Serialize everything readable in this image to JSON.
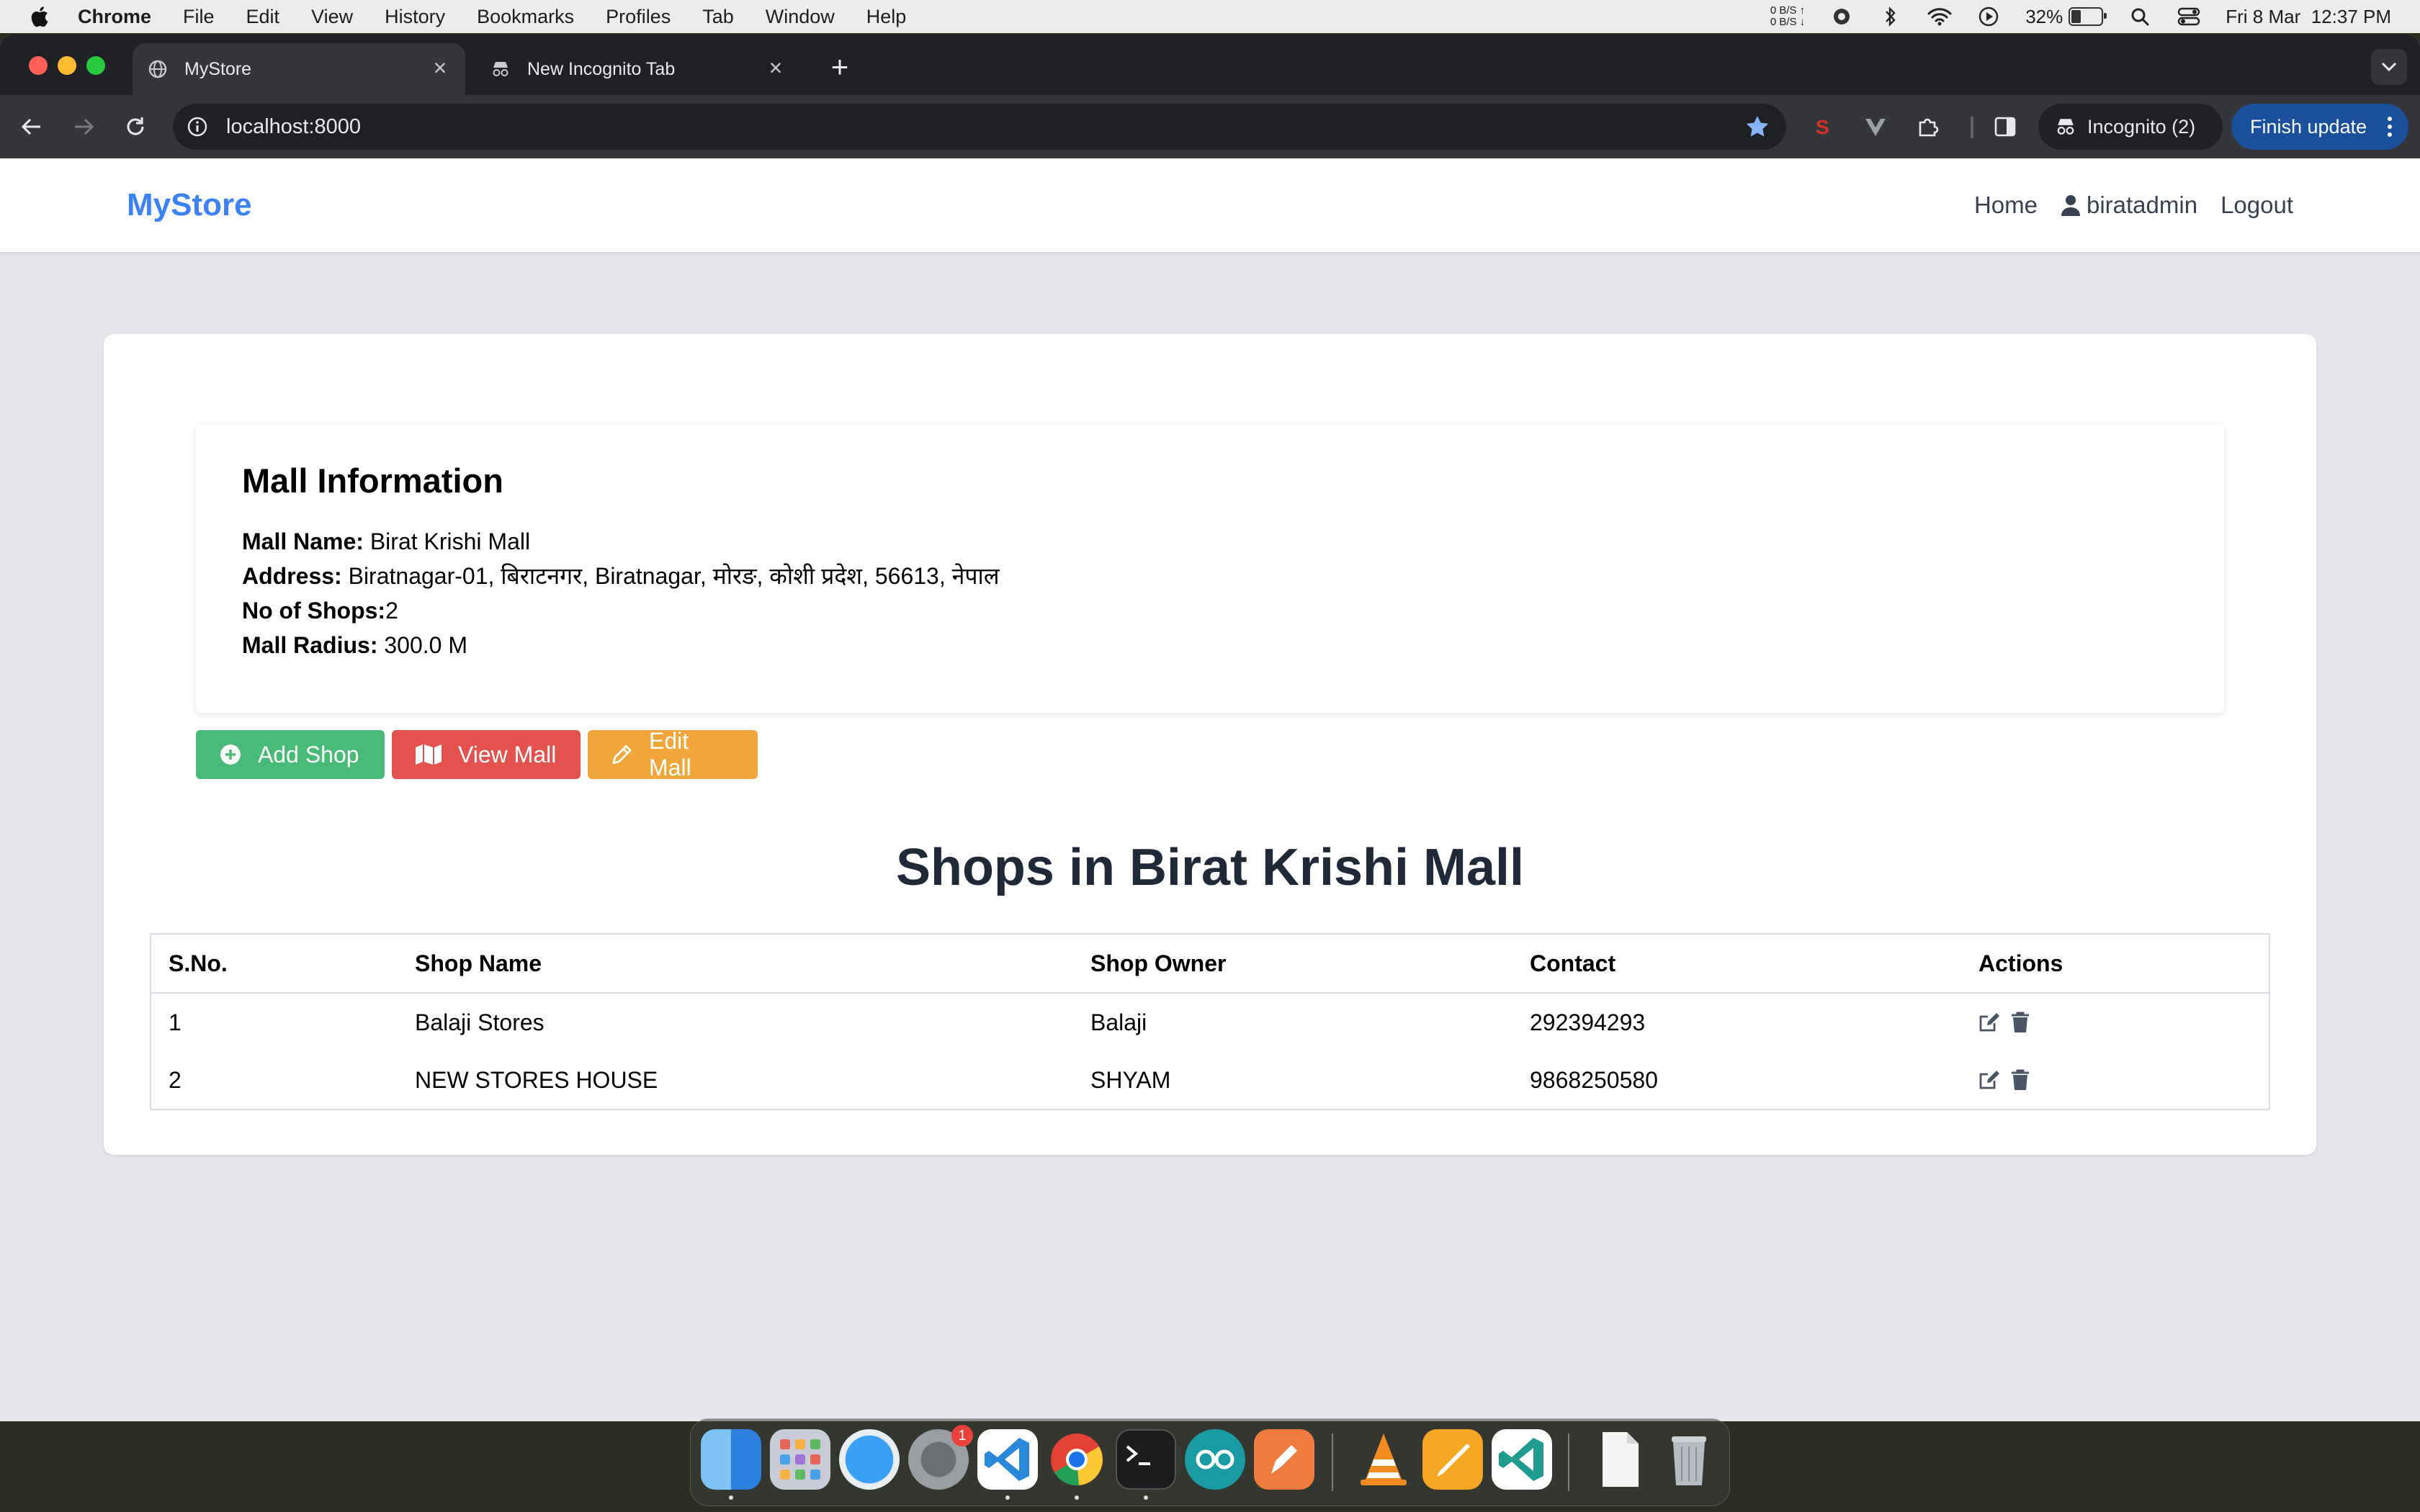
{
  "menubar": {
    "app_name": "Chrome",
    "items": [
      "File",
      "Edit",
      "View",
      "History",
      "Bookmarks",
      "Profiles",
      "Tab",
      "Window",
      "Help"
    ],
    "net_up": "0 B/S ↑",
    "net_down": "0 B/S ↓",
    "battery": "32%",
    "battery_level": 0.32,
    "datetime": "Fri 8 Mar  12:37 PM"
  },
  "browser": {
    "tabs": [
      {
        "title": "MyStore"
      },
      {
        "title": "New Incognito Tab"
      }
    ],
    "url": "localhost:8000",
    "incognito_label": "Incognito (2)",
    "finish_update_label": "Finish update"
  },
  "site": {
    "brand": "MyStore",
    "nav": {
      "home": "Home",
      "user": "biratadmin",
      "logout": "Logout"
    }
  },
  "mall": {
    "section_title": "Mall Information",
    "name_label": "Mall Name:",
    "name": "Birat Krishi Mall",
    "address_label": "Address:",
    "address": "Biratnagar-01, बिराटनगर, Biratnagar, मोरङ, कोशी प्रदेश, 56613, नेपाल",
    "shops_label": "No of Shops:",
    "shops_count": "2",
    "radius_label": "Mall Radius:",
    "radius": "300.0 M"
  },
  "actions": {
    "add_shop": "Add Shop",
    "view_mall": "View Mall",
    "edit_mall": "Edit Mall"
  },
  "shops": {
    "title": "Shops in Birat Krishi Mall",
    "columns": [
      "S.No.",
      "Shop Name",
      "Shop Owner",
      "Contact",
      "Actions"
    ],
    "rows": [
      {
        "sno": "1",
        "name": "Balaji Stores",
        "owner": "Balaji",
        "contact": "292394293"
      },
      {
        "sno": "2",
        "name": "NEW STORES HOUSE",
        "owner": "SHYAM",
        "contact": "9868250580"
      }
    ]
  },
  "dock": {
    "apps": [
      "finder-icon",
      "launchpad-icon",
      "safari-icon",
      "system-settings-icon",
      "vscode-icon",
      "chrome-icon",
      "terminal-icon",
      "arduino-icon",
      "sketch-icon",
      "vlc-icon",
      "pages-icon",
      "vscode-insiders-icon",
      "document-icon",
      "trash-icon"
    ],
    "settings_badge": "1"
  },
  "colors": {
    "brand": "#3b82f6",
    "add": "#48bb78",
    "view": "#e3524f",
    "edit": "#f0a63a"
  }
}
